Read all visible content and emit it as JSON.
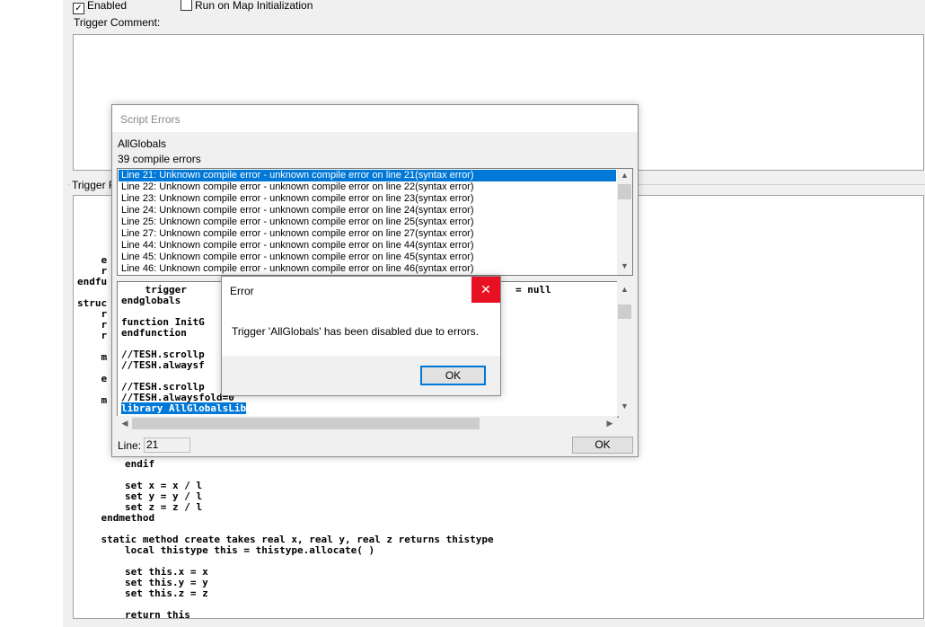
{
  "editor": {
    "enabled_label": "Enabled",
    "enabled_checked": true,
    "run_on_init_label": "Run on Map Initialization",
    "comment_label": "Trigger Comment:",
    "functions_label": "Trigger Fu",
    "code_lines_top": [
      "    e",
      "    r",
      "endfu",
      "",
      "struc",
      "    r",
      "    r",
      "    r",
      "",
      "    m",
      "",
      "    e",
      "",
      "    m"
    ],
    "code_lines_bottom": [
      "        endif",
      "",
      "        set x = x / l",
      "        set y = y / l",
      "        set z = z / l",
      "    endmethod",
      "",
      "    static method create takes real x, real y, real z returns thistype",
      "        local thistype this = thistype.allocate( )",
      "",
      "        set this.x = x",
      "        set this.y = y",
      "        set this.z = z",
      "",
      "        return this"
    ]
  },
  "script_errors": {
    "title": "Script Errors",
    "trigger_name": "AllGlobals",
    "count_text": "39 compile errors",
    "errors": [
      "Line  21: Unknown compile error - unknown compile error on line 21(syntax error)",
      "Line  22: Unknown compile error - unknown compile error on line 22(syntax error)",
      "Line  23: Unknown compile error - unknown compile error on line 23(syntax error)",
      "Line  24: Unknown compile error - unknown compile error on line 24(syntax error)",
      "Line  25: Unknown compile error - unknown compile error on line 25(syntax error)",
      "Line  27: Unknown compile error - unknown compile error on line 27(syntax error)",
      "Line  44: Unknown compile error - unknown compile error on line 44(syntax error)",
      "Line  45: Unknown compile error - unknown compile error on line 45(syntax error)",
      "Line  46: Unknown compile error - unknown compile error on line 46(syntax error)"
    ],
    "source_lines": [
      "    trigger",
      "endglobals",
      "",
      "function InitG",
      "endfunction",
      "",
      "//TESH.scrollp",
      "//TESH.alwaysf",
      "",
      "//TESH.scrollp",
      "//TESH.alwaysfold=0"
    ],
    "source_right_fragment": "= null",
    "selected_source_line": "library AllGlobalsLib",
    "line_label": "Line:",
    "line_value": "21",
    "ok_label": "OK"
  },
  "error_dialog": {
    "title": "Error",
    "close_glyph": "✕",
    "message": "Trigger 'AllGlobals' has been disabled due to errors.",
    "ok_label": "OK"
  },
  "colors": {
    "selection": "#0078d7",
    "close_button": "#e81123"
  }
}
